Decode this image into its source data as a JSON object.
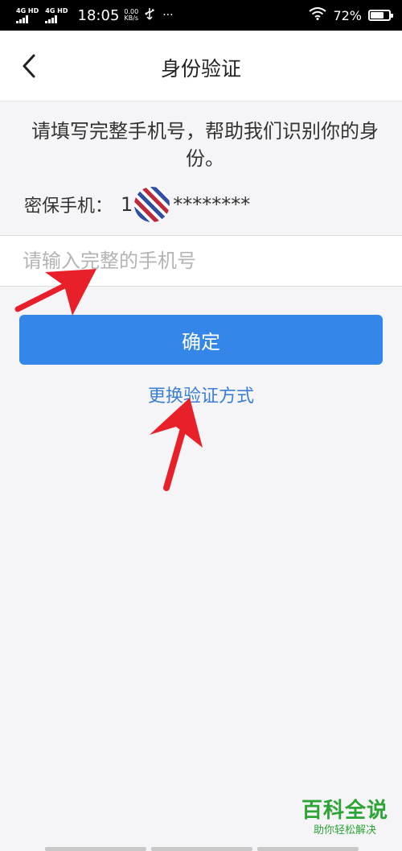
{
  "status_bar": {
    "network_1": "4G HD",
    "network_2": "4G HD",
    "time": "18:05",
    "speed_value": "0.00",
    "speed_unit": "KB/s",
    "usb_icon": "usb-icon",
    "more": "···",
    "wifi_icon": "wifi-icon",
    "battery_percent": "72%",
    "battery_level": 0.72
  },
  "header": {
    "back_icon": "chevron-left-icon",
    "title": "身份验证"
  },
  "content": {
    "prompt": "请填写完整手机号，帮助我们识别你的身份。",
    "phone_label": "密保手机：",
    "phone_prefix": "1",
    "phone_mask": "********",
    "input_placeholder": "请输入完整的手机号",
    "confirm_label": "确定",
    "switch_method_label": "更换验证方式"
  },
  "watermark": {
    "title": "百科全说",
    "subtitle": "助你轻松解决"
  },
  "colors": {
    "accent": "#3486e8",
    "link": "#3a7fd4",
    "annotation": "#e8202a",
    "watermark": "#2ca436"
  }
}
